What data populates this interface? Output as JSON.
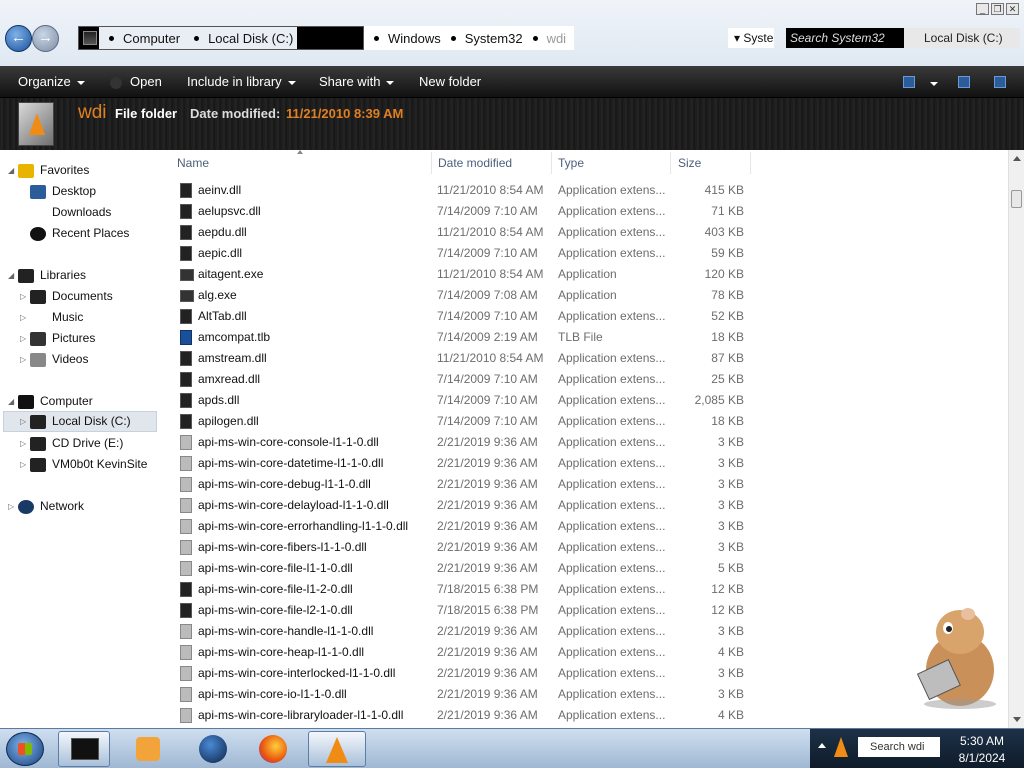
{
  "window": {
    "breadcrumbs": [
      "Computer",
      "Local Disk (C:)",
      "Windows",
      "System32",
      "wdi"
    ],
    "address_dropdown_text": "Syste",
    "search_placeholder": "Search System32",
    "search_location": "Local Disk (C:)"
  },
  "toolbar": {
    "organize": "Organize",
    "open": "Open",
    "include_in_library": "Include in library",
    "share_with": "Share with",
    "new_folder": "New folder"
  },
  "details": {
    "folder_name": "wdi",
    "folder_type": "File folder",
    "date_label": "Date modified:",
    "date_value": "11/21/2010 8:39 AM"
  },
  "nav": {
    "favorites": "Favorites",
    "desktop": "Desktop",
    "downloads": "Downloads",
    "recent_places": "Recent Places",
    "libraries": "Libraries",
    "documents": "Documents",
    "music": "Music",
    "pictures": "Pictures",
    "videos": "Videos",
    "computer": "Computer",
    "local_disk": "Local Disk (C:)",
    "cd_drive": "CD Drive (E:)",
    "vm_share": "VM0b0t KevinSite",
    "network": "Network"
  },
  "columns": {
    "name": "Name",
    "date_modified": "Date modified",
    "type": "Type",
    "size": "Size"
  },
  "files": [
    {
      "name": "aeinv.dll",
      "date": "11/21/2010 8:54 AM",
      "type": "Application extens...",
      "size": "415 KB",
      "icon": "dll-dark"
    },
    {
      "name": "aelupsvc.dll",
      "date": "7/14/2009 7:10 AM",
      "type": "Application extens...",
      "size": "71 KB",
      "icon": "dll-dark"
    },
    {
      "name": "aepdu.dll",
      "date": "11/21/2010 8:54 AM",
      "type": "Application extens...",
      "size": "403 KB",
      "icon": "dll-dark"
    },
    {
      "name": "aepic.dll",
      "date": "7/14/2009 7:10 AM",
      "type": "Application extens...",
      "size": "59 KB",
      "icon": "dll-dark"
    },
    {
      "name": "aitagent.exe",
      "date": "11/21/2010 8:54 AM",
      "type": "Application",
      "size": "120 KB",
      "icon": "exe"
    },
    {
      "name": "alg.exe",
      "date": "7/14/2009 7:08 AM",
      "type": "Application",
      "size": "78 KB",
      "icon": "exe"
    },
    {
      "name": "AltTab.dll",
      "date": "7/14/2009 7:10 AM",
      "type": "Application extens...",
      "size": "52 KB",
      "icon": "dll-dark"
    },
    {
      "name": "amcompat.tlb",
      "date": "7/14/2009 2:19 AM",
      "type": "TLB File",
      "size": "18 KB",
      "icon": "tlb"
    },
    {
      "name": "amstream.dll",
      "date": "11/21/2010 8:54 AM",
      "type": "Application extens...",
      "size": "87 KB",
      "icon": "dll-dark"
    },
    {
      "name": "amxread.dll",
      "date": "7/14/2009 7:10 AM",
      "type": "Application extens...",
      "size": "25 KB",
      "icon": "dll-dark"
    },
    {
      "name": "apds.dll",
      "date": "7/14/2009 7:10 AM",
      "type": "Application extens...",
      "size": "2,085 KB",
      "icon": "dll-dark"
    },
    {
      "name": "apilogen.dll",
      "date": "7/14/2009 7:10 AM",
      "type": "Application extens...",
      "size": "18 KB",
      "icon": "dll-dark"
    },
    {
      "name": "api-ms-win-core-console-l1-1-0.dll",
      "date": "2/21/2019 9:36 AM",
      "type": "Application extens...",
      "size": "3 KB",
      "icon": "dll-light"
    },
    {
      "name": "api-ms-win-core-datetime-l1-1-0.dll",
      "date": "2/21/2019 9:36 AM",
      "type": "Application extens...",
      "size": "3 KB",
      "icon": "dll-light"
    },
    {
      "name": "api-ms-win-core-debug-l1-1-0.dll",
      "date": "2/21/2019 9:36 AM",
      "type": "Application extens...",
      "size": "3 KB",
      "icon": "dll-light"
    },
    {
      "name": "api-ms-win-core-delayload-l1-1-0.dll",
      "date": "2/21/2019 9:36 AM",
      "type": "Application extens...",
      "size": "3 KB",
      "icon": "dll-light"
    },
    {
      "name": "api-ms-win-core-errorhandling-l1-1-0.dll",
      "date": "2/21/2019 9:36 AM",
      "type": "Application extens...",
      "size": "3 KB",
      "icon": "dll-light"
    },
    {
      "name": "api-ms-win-core-fibers-l1-1-0.dll",
      "date": "2/21/2019 9:36 AM",
      "type": "Application extens...",
      "size": "3 KB",
      "icon": "dll-light"
    },
    {
      "name": "api-ms-win-core-file-l1-1-0.dll",
      "date": "2/21/2019 9:36 AM",
      "type": "Application extens...",
      "size": "5 KB",
      "icon": "dll-light"
    },
    {
      "name": "api-ms-win-core-file-l1-2-0.dll",
      "date": "7/18/2015 6:38 PM",
      "type": "Application extens...",
      "size": "12 KB",
      "icon": "dll-dark"
    },
    {
      "name": "api-ms-win-core-file-l2-1-0.dll",
      "date": "7/18/2015 6:38 PM",
      "type": "Application extens...",
      "size": "12 KB",
      "icon": "dll-dark"
    },
    {
      "name": "api-ms-win-core-handle-l1-1-0.dll",
      "date": "2/21/2019 9:36 AM",
      "type": "Application extens...",
      "size": "3 KB",
      "icon": "dll-light"
    },
    {
      "name": "api-ms-win-core-heap-l1-1-0.dll",
      "date": "2/21/2019 9:36 AM",
      "type": "Application extens...",
      "size": "4 KB",
      "icon": "dll-light"
    },
    {
      "name": "api-ms-win-core-interlocked-l1-1-0.dll",
      "date": "2/21/2019 9:36 AM",
      "type": "Application extens...",
      "size": "3 KB",
      "icon": "dll-light"
    },
    {
      "name": "api-ms-win-core-io-l1-1-0.dll",
      "date": "2/21/2019 9:36 AM",
      "type": "Application extens...",
      "size": "3 KB",
      "icon": "dll-light"
    },
    {
      "name": "api-ms-win-core-libraryloader-l1-1-0.dll",
      "date": "2/21/2019 9:36 AM",
      "type": "Application extens...",
      "size": "4 KB",
      "icon": "dll-light"
    }
  ],
  "taskbar": {
    "tray_search": "Search wdi",
    "time": "5:30 AM",
    "date": "8/1/2024"
  },
  "colors": {
    "accent_orange": "#e08020",
    "command_bar": "#1b1b1b",
    "header_text": "#4c607a"
  }
}
